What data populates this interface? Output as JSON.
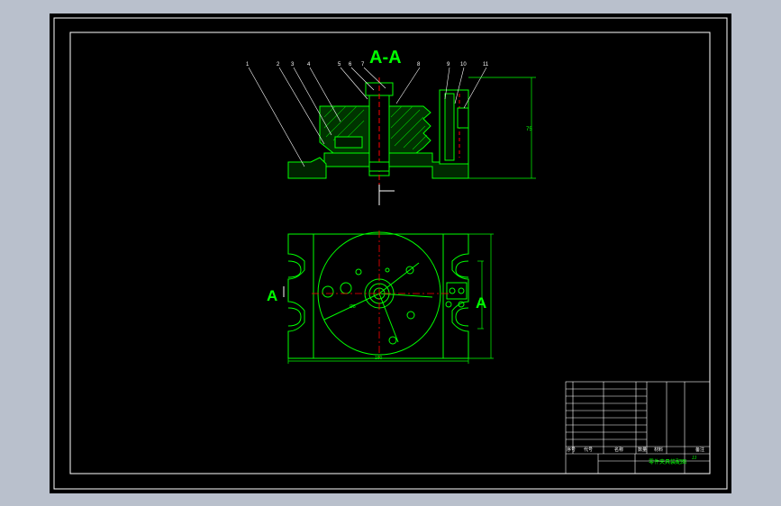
{
  "title_section": "A-A",
  "view_label_left": "A",
  "view_label_right": "A",
  "balloons": [
    "1",
    "2",
    "3",
    "4",
    "5",
    "6",
    "7",
    "8",
    "9",
    "10",
    "11"
  ],
  "dimension_height": "75",
  "dimension_width": "160",
  "dimension_diameter": "Ø8",
  "title_block": {
    "header": [
      "序号",
      "代号",
      "名称",
      "数量",
      "材料",
      "备注"
    ],
    "drawing_name": "零件夹具装配图",
    "drawing_no": "JJ"
  },
  "colors": {
    "background": "#000000",
    "frame": "#ffffff",
    "part": "#00ff00",
    "center": "#ff0000",
    "title": "#00ff00",
    "hatch": "#00ff00"
  }
}
